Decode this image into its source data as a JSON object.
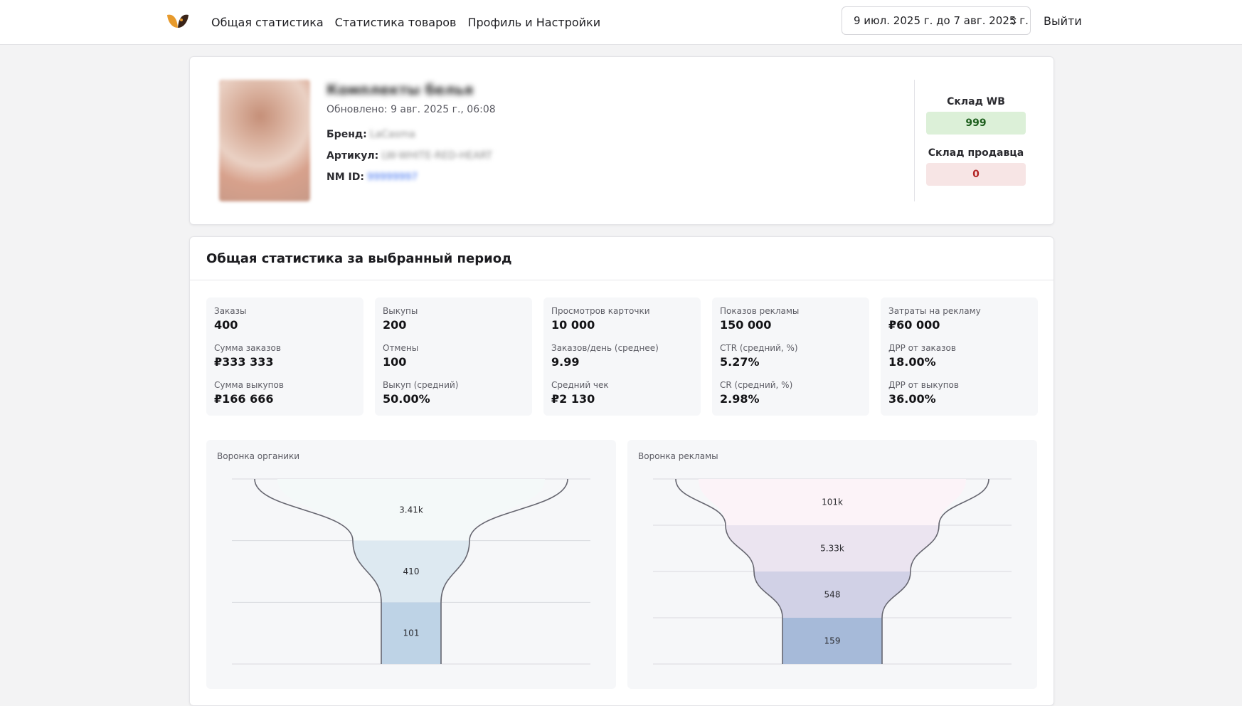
{
  "header": {
    "nav": [
      "Общая статистика",
      "Статистика товаров",
      "Профиль и Настройки"
    ],
    "date_range": "9 июл. 2025 г. до 7 авг. 2025 г.",
    "logout": "Выйти"
  },
  "product": {
    "title": "Комплекты белья",
    "updated": "Обновлено: 9 авг. 2025 г., 06:08",
    "brand_label": "Бренд:",
    "brand_value": "LaCasma",
    "article_label": "Артикул:",
    "article_value": "LW-WHITE-RED-HEART",
    "nmid_label": "NM ID:",
    "nmid_value": "99999997",
    "stock_wb_label": "Склад WB",
    "stock_wb_value": "999",
    "stock_seller_label": "Склад продавца",
    "stock_seller_value": "0"
  },
  "stats": {
    "title": "Общая статистика за выбранный период",
    "columns": [
      [
        {
          "label": "Заказы",
          "value": "400"
        },
        {
          "label": "Сумма заказов",
          "value": "₽333 333"
        },
        {
          "label": "Сумма выкупов",
          "value": "₽166 666"
        }
      ],
      [
        {
          "label": "Выкупы",
          "value": "200"
        },
        {
          "label": "Отмены",
          "value": "100"
        },
        {
          "label": "Выкуп (средний)",
          "value": "50.00%"
        }
      ],
      [
        {
          "label": "Просмотров карточки",
          "value": "10 000"
        },
        {
          "label": "Заказов/день (среднее)",
          "value": "9.99"
        },
        {
          "label": "Средний чек",
          "value": "₽2 130"
        }
      ],
      [
        {
          "label": "Показов рекламы",
          "value": "150 000"
        },
        {
          "label": "CTR (средний, %)",
          "value": "5.27%"
        },
        {
          "label": "CR (средний, %)",
          "value": "2.98%"
        }
      ],
      [
        {
          "label": "Затраты на рекламу",
          "value": "₽60 000"
        },
        {
          "label": "ДРР от заказов",
          "value": "18.00%"
        },
        {
          "label": "ДРР от выкупов",
          "value": "36.00%"
        }
      ]
    ]
  },
  "funnels": [
    {
      "title": "Воронка органики",
      "stages": [
        {
          "label": "3.41k",
          "color": "#f4f9f9"
        },
        {
          "label": "410",
          "color": "#dde9f1"
        },
        {
          "label": "101",
          "color": "#bed3e6"
        }
      ]
    },
    {
      "title": "Воронка рекламы",
      "stages": [
        {
          "label": "101k",
          "color": "#fcf3f8"
        },
        {
          "label": "5.33k",
          "color": "#ebe4f0"
        },
        {
          "label": "548",
          "color": "#d1d1e6"
        },
        {
          "label": "159",
          "color": "#a6bad9"
        }
      ]
    }
  ],
  "colors": {
    "stock_wb_bg": "#dcf0d8",
    "stock_wb_text": "#1d5e1d",
    "stock_seller_bg": "#f7e5e5",
    "stock_seller_text": "#b32525",
    "funnel_outline": "#666670"
  }
}
